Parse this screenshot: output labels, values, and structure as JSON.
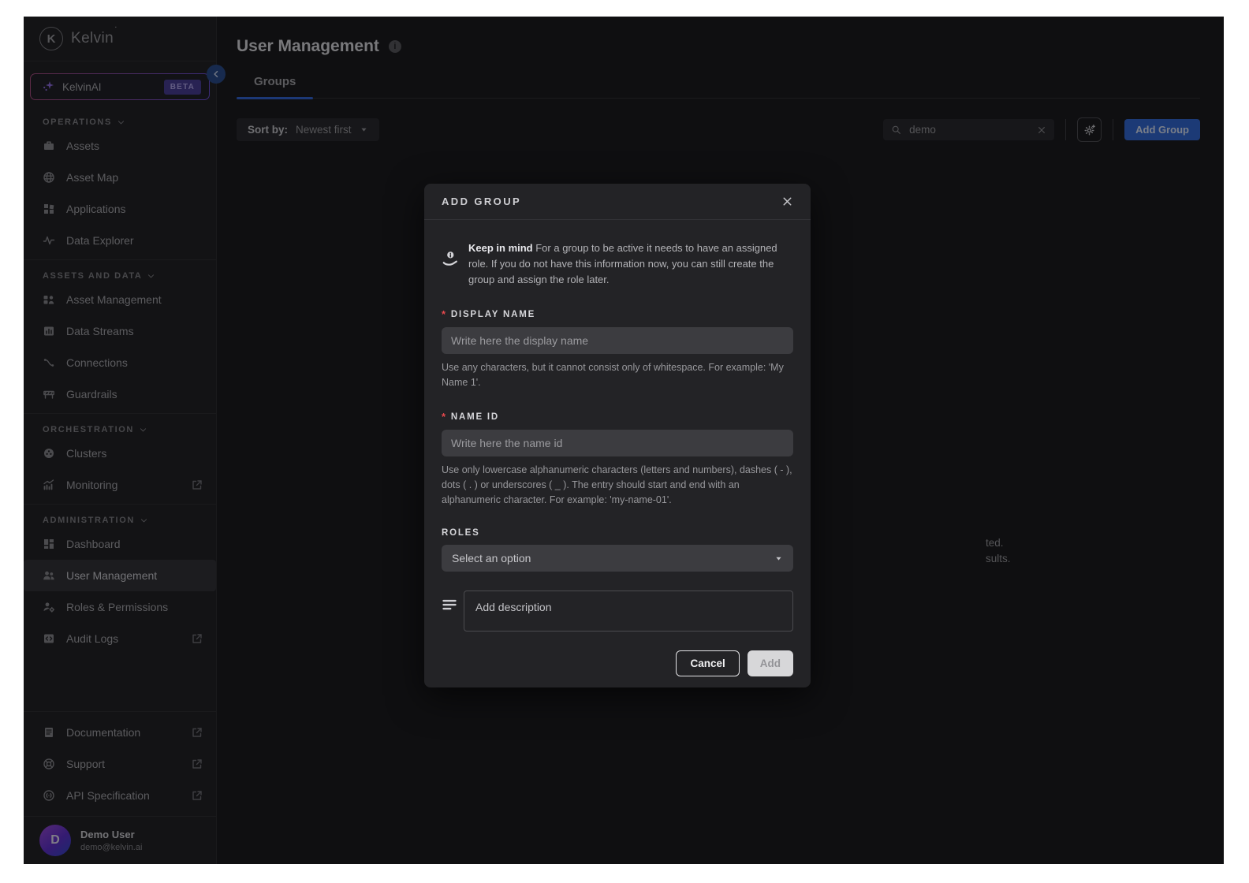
{
  "sidebar": {
    "brand": "Kelvin",
    "brand_initial": "K",
    "ai_item": {
      "label": "KelvinAI",
      "badge": "BETA",
      "icon": "sparkle-icon"
    },
    "sections": [
      {
        "label": "OPERATIONS",
        "items": [
          {
            "label": "Assets",
            "icon": "assets-icon",
            "active": false,
            "external": false
          },
          {
            "label": "Asset Map",
            "icon": "asset-map-icon",
            "active": false,
            "external": false
          },
          {
            "label": "Applications",
            "icon": "applications-icon",
            "active": false,
            "external": false
          },
          {
            "label": "Data Explorer",
            "icon": "data-explorer-icon",
            "active": false,
            "external": false
          }
        ]
      },
      {
        "label": "ASSETS AND DATA",
        "items": [
          {
            "label": "Asset Management",
            "icon": "asset-management-icon",
            "active": false,
            "external": false
          },
          {
            "label": "Data Streams",
            "icon": "data-streams-icon",
            "active": false,
            "external": false
          },
          {
            "label": "Connections",
            "icon": "connections-icon",
            "active": false,
            "external": false
          },
          {
            "label": "Guardrails",
            "icon": "guardrails-icon",
            "active": false,
            "external": false
          }
        ]
      },
      {
        "label": "ORCHESTRATION",
        "items": [
          {
            "label": "Clusters",
            "icon": "clusters-icon",
            "active": false,
            "external": false
          },
          {
            "label": "Monitoring",
            "icon": "monitoring-icon",
            "active": false,
            "external": true
          }
        ]
      },
      {
        "label": "ADMINISTRATION",
        "items": [
          {
            "label": "Dashboard",
            "icon": "dashboard-icon",
            "active": false,
            "external": false
          },
          {
            "label": "User Management",
            "icon": "user-management-icon",
            "active": true,
            "external": false
          },
          {
            "label": "Roles & Permissions",
            "icon": "roles-permissions-icon",
            "active": false,
            "external": false
          },
          {
            "label": "Audit Logs",
            "icon": "audit-logs-icon",
            "active": false,
            "external": true
          }
        ]
      }
    ],
    "footer_items": [
      {
        "label": "Documentation",
        "icon": "documentation-icon",
        "external": true
      },
      {
        "label": "Support",
        "icon": "support-icon",
        "external": true
      },
      {
        "label": "API Specification",
        "icon": "api-specification-icon",
        "external": true
      }
    ],
    "user": {
      "initial": "D",
      "name": "Demo User",
      "email": "demo@kelvin.ai"
    }
  },
  "header": {
    "title": "User Management",
    "tabs": [
      {
        "label": "Groups",
        "active": true
      }
    ]
  },
  "toolbar": {
    "sort_label": "Sort by:",
    "sort_value": "Newest first",
    "search_value": "demo",
    "add_group_label": "Add Group"
  },
  "background_fragments": {
    "line1": "ted.",
    "line2": "sults."
  },
  "modal": {
    "title": "ADD GROUP",
    "note_bold": "Keep in mind",
    "note_text": " For a group to be active it needs to have an assigned role. If you do not have this information now, you can still create the group and assign the role later.",
    "fields": {
      "display_name": {
        "label": "DISPLAY NAME",
        "placeholder": "Write here the display name",
        "helper": "Use any characters, but it cannot consist only of whitespace. For example: 'My Name 1'."
      },
      "name_id": {
        "label": "NAME ID",
        "placeholder": "Write here the name id",
        "helper": "Use only lowercase alphanumeric characters (letters and numbers), dashes ( - ), dots ( . ) or underscores ( _ ). The entry should start and end with an alphanumeric character. For example: 'my-name-01'."
      },
      "roles": {
        "label": "ROLES",
        "value": "Select an option"
      },
      "description": {
        "placeholder": "Add description"
      }
    },
    "buttons": {
      "cancel": "Cancel",
      "add": "Add"
    }
  },
  "colors": {
    "accent_blue": "#2f66d6",
    "badge_purple": "#443a93",
    "danger": "#e5484d",
    "tab_underline": "#2f62d6"
  }
}
